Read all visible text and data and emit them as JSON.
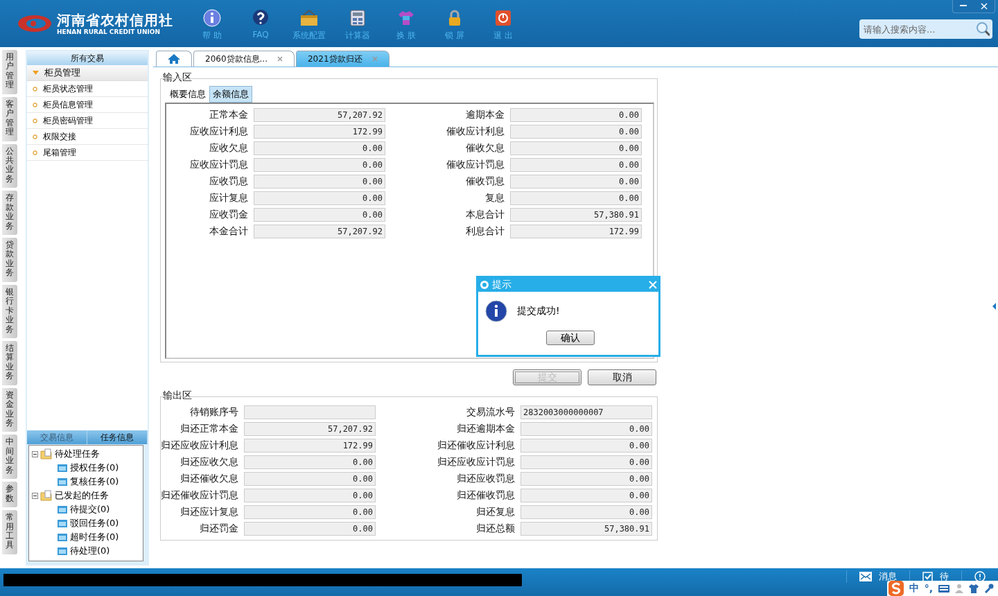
{
  "header": {
    "logo": {
      "name_cn": "河南省农村信用社",
      "name_en": "HENAN RURAL CREDIT UNION"
    },
    "toolbar": [
      {
        "kind": "help",
        "label": "帮 助"
      },
      {
        "kind": "faq",
        "label": "FAQ"
      },
      {
        "kind": "config",
        "label": "系统配置"
      },
      {
        "kind": "calculator",
        "label": "计算器"
      },
      {
        "kind": "skin",
        "label": "换 肤"
      },
      {
        "kind": "lock",
        "label": "锁 屏"
      },
      {
        "kind": "exit",
        "label": "退 出"
      }
    ],
    "search": {
      "placeholder": "请输入搜索内容..."
    }
  },
  "left_nav": [
    "用户管理",
    "客户管理",
    "公共业务",
    "存款业务",
    "贷款业务",
    "银行卡业务",
    "结算业务",
    "资金业务",
    "中间业务",
    "参数",
    "常用工具"
  ],
  "sidebar": {
    "title": "所有交易",
    "groups": [
      {
        "label": "柜员管理",
        "expanded": true,
        "items": [
          "柜员状态管理",
          "柜员信息管理",
          "柜员密码管理",
          "权限交接",
          "尾箱管理"
        ]
      }
    ],
    "bottom_tabs": [
      {
        "label": "交易信息",
        "selected": false
      },
      {
        "label": "任务信息",
        "selected": true
      }
    ],
    "tree": [
      {
        "label": "待处理任务",
        "expanded": true,
        "children": [
          {
            "label": "授权任务(0)"
          },
          {
            "label": "复核任务(0)"
          }
        ]
      },
      {
        "label": "已发起的任务",
        "expanded": true,
        "children": [
          {
            "label": "待提交(0)"
          },
          {
            "label": "驳回任务(0)"
          },
          {
            "label": "超时任务(0)"
          },
          {
            "label": "待处理(0)"
          }
        ]
      }
    ]
  },
  "tabs": [
    {
      "kind": "home",
      "selected": false
    },
    {
      "kind": "page",
      "label": "2060贷款信息...",
      "selected": false
    },
    {
      "kind": "page",
      "label": "2021贷款归还",
      "selected": true
    }
  ],
  "input_area": {
    "title": "输入区",
    "tabs": [
      {
        "label": "概要信息",
        "selected": false
      },
      {
        "label": "余额信息",
        "selected": true
      }
    ],
    "fields_left": [
      {
        "label": "正常本金",
        "value": "57,207.92"
      },
      {
        "label": "应收应计利息",
        "value": "172.99"
      },
      {
        "label": "应收欠息",
        "value": "0.00"
      },
      {
        "label": "应收应计罚息",
        "value": "0.00"
      },
      {
        "label": "应收罚息",
        "value": "0.00"
      },
      {
        "label": "应计复息",
        "value": "0.00"
      },
      {
        "label": "应收罚金",
        "value": "0.00"
      },
      {
        "label": "本金合计",
        "value": "57,207.92"
      }
    ],
    "fields_right": [
      {
        "label": "逾期本金",
        "value": "0.00"
      },
      {
        "label": "催收应计利息",
        "value": "0.00"
      },
      {
        "label": "催收欠息",
        "value": "0.00"
      },
      {
        "label": "催收应计罚息",
        "value": "0.00"
      },
      {
        "label": "催收罚息",
        "value": "0.00"
      },
      {
        "label": "复息",
        "value": "0.00"
      },
      {
        "label": "本息合计",
        "value": "57,380.91"
      },
      {
        "label": "利息合计",
        "value": "172.99"
      }
    ]
  },
  "buttons": [
    {
      "label": "提交",
      "disabled": true
    },
    {
      "label": "取消",
      "disabled": false
    }
  ],
  "output_area": {
    "title": "输出区",
    "fields_left": [
      {
        "label": "待销账序号"
      },
      {
        "label": "归还正常本金",
        "value": "57,207.92"
      },
      {
        "label": "归还应收应计利息",
        "value": "172.99"
      },
      {
        "label": "归还应收欠息",
        "value": "0.00"
      },
      {
        "label": "归还催收欠息",
        "value": "0.00"
      },
      {
        "label": "归还催收应计罚息",
        "value": "0.00"
      },
      {
        "label": "归还应计复息",
        "value": "0.00"
      },
      {
        "label": "归还罚金",
        "value": "0.00"
      }
    ],
    "fields_right": [
      {
        "label": "交易流水号",
        "value": "2832003000000007",
        "kind": "text"
      },
      {
        "label": "归还逾期本金",
        "value": "0.00"
      },
      {
        "label": "归还催收应计利息",
        "value": "0.00"
      },
      {
        "label": "归还应收应计罚息",
        "value": "0.00"
      },
      {
        "label": "归还应收罚息",
        "value": "0.00"
      },
      {
        "label": "归还催收罚息",
        "value": "0.00"
      },
      {
        "label": "归还复息",
        "value": "0.00"
      },
      {
        "label": "归还总额",
        "value": "57,380.91"
      }
    ]
  },
  "dialog": {
    "title": "提示",
    "message": "提交成功!",
    "button": "确认"
  },
  "status_bar": {
    "items": [
      {
        "kind": "mail",
        "label": "消息"
      },
      {
        "kind": "todo",
        "label": "待"
      },
      {
        "kind": "risk"
      }
    ]
  },
  "ime_toolbar": {
    "items": [
      "中",
      "°,"
    ]
  }
}
